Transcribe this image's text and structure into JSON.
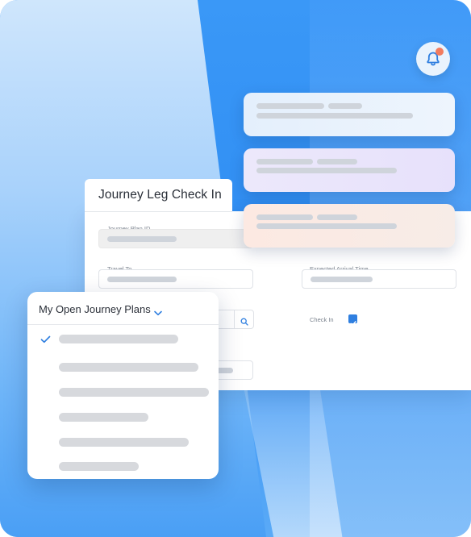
{
  "form": {
    "title": "Journey Leg Check In",
    "fields": {
      "journey_plan_id": "Journey Plan ID",
      "travel_to": "Travel To",
      "expected_arrival_time": "Expected Arrival Time",
      "check_in": "Check In"
    },
    "check_in_checked": true
  },
  "dropdown": {
    "title": "My Open Journey Plans",
    "selected_index": 0
  },
  "notifications": {
    "count": 3,
    "has_unread": true
  },
  "colors": {
    "accent": "#2f7fe0",
    "notification_dot": "#f27b5e",
    "background_blue": "#2e8cf2"
  },
  "icons": [
    "bell-icon",
    "search-icon",
    "checkmark-icon",
    "chevron-down-icon"
  ]
}
